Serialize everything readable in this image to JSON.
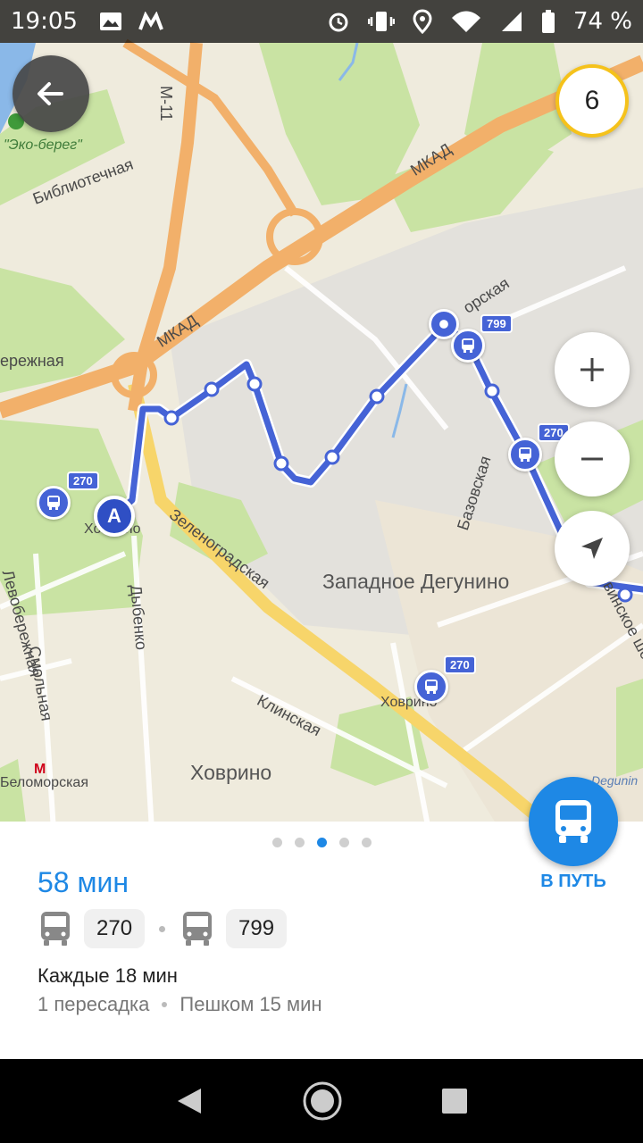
{
  "status_bar": {
    "time": "19:05",
    "battery": "74 %"
  },
  "map": {
    "labels": {
      "eco_bereg": "\"Эко-берег\"",
      "bibliotechnaya": "Библиотечная",
      "m11": "М-11",
      "mkad_top": "МКАД",
      "mkad_left": "МКАД",
      "naberezhnaya": "ережная",
      "beloморская_top": "орская",
      "bazovskaya": "Базовская",
      "zapadnoe_degunino": "Западное Дегунино",
      "zelenogradskaya": "Зеленоградская",
      "dybenko": "Дыбенко",
      "levoberezhnaya": "Левобережная",
      "smolnaya": "Смольная",
      "khovrino_left": "Ховрино",
      "khovrino_station": "Ховрино",
      "klinskaya": "Клинская",
      "khovrino_district": "Ховрино",
      "belomorskaya": "Беломорская",
      "korovinskoe": "Коровинское шоссе",
      "degunino_en": "Degunin"
    },
    "route_tags": {
      "tag_270_left": "270",
      "tag_799": "799",
      "tag_270_right": "270",
      "tag_270_station": "270"
    },
    "start_marker": "A",
    "badge_count": "6",
    "colors": {
      "route": "#4563d6",
      "land": "#efebdd",
      "park": "#c9e3a3",
      "highway": "#f2b06a",
      "arterial": "#f7d56a",
      "water": "#8ab8e8"
    }
  },
  "action": {
    "go_label": "В ПУТЬ"
  },
  "route_card": {
    "duration": "58 мин",
    "routes": [
      "270",
      "799"
    ],
    "frequency": "Каждые 18 мин",
    "transfers": "1 пересадка",
    "walking": "Пешком 15 мин",
    "pages": 5,
    "active_page": 3
  }
}
